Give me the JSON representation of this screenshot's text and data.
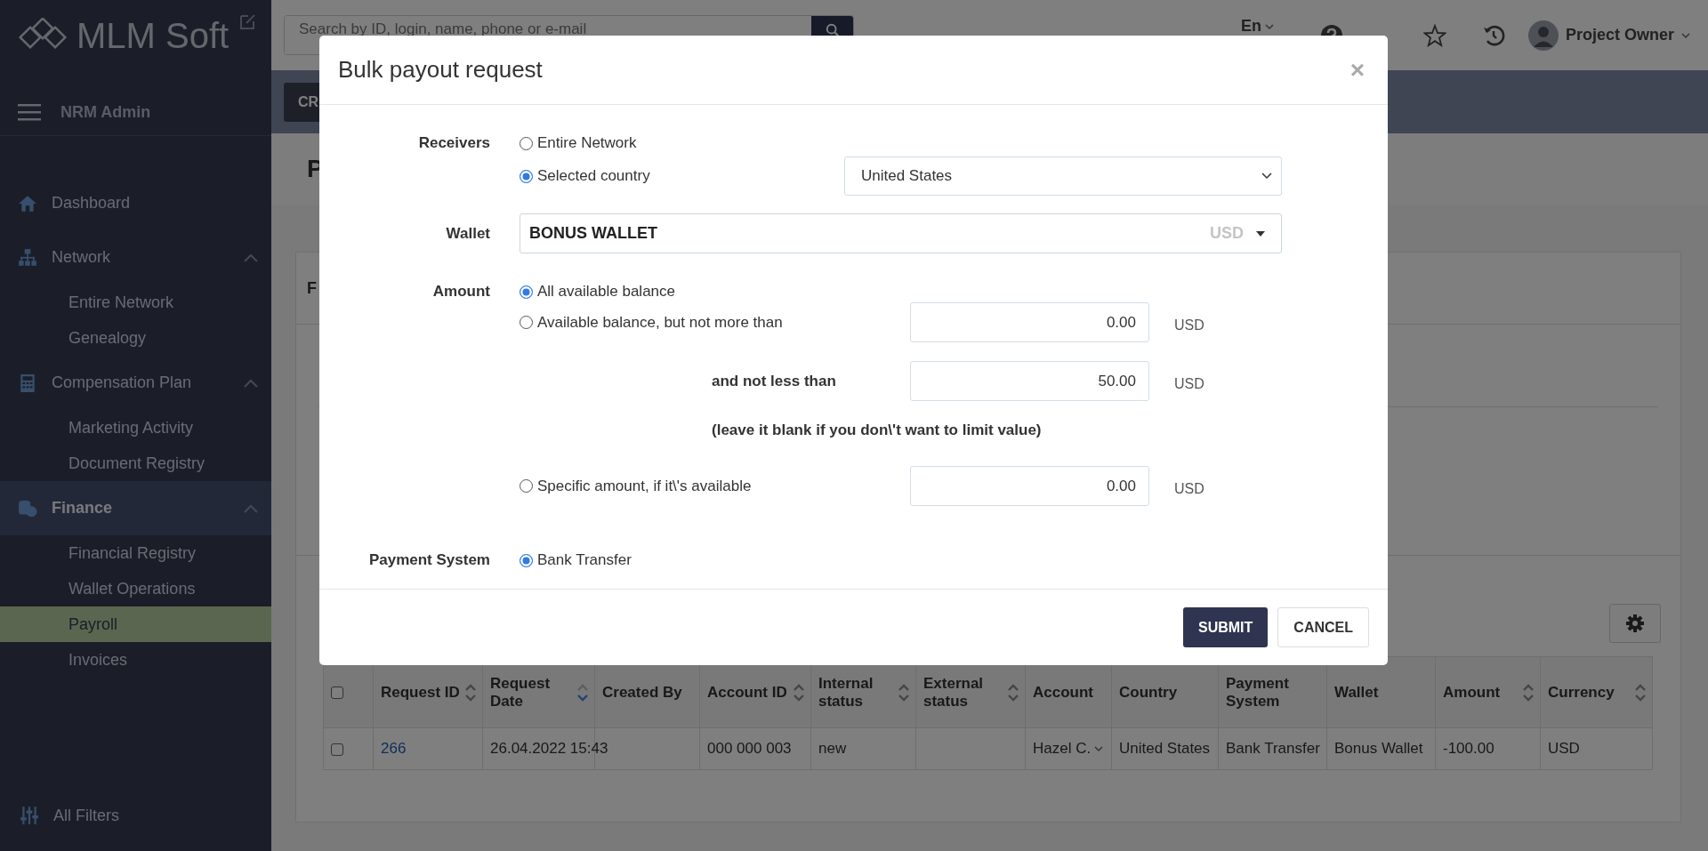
{
  "sidebar": {
    "logo": "MLM Soft",
    "title": "NRM Admin",
    "items": [
      {
        "label": "Dashboard",
        "selected": false
      },
      {
        "label": "Network",
        "selected": false,
        "expanded": true,
        "children": [
          {
            "label": "Entire Network",
            "selected": false
          },
          {
            "label": "Genealogy",
            "selected": false
          }
        ]
      },
      {
        "label": "Compensation Plan",
        "selected": false,
        "expanded": true,
        "children": [
          {
            "label": "Marketing Activity",
            "selected": false
          },
          {
            "label": "Document Registry",
            "selected": false
          }
        ]
      },
      {
        "label": "Finance",
        "selected": true,
        "expanded": true,
        "children": [
          {
            "label": "Financial Registry",
            "selected": false
          },
          {
            "label": "Wallet Operations",
            "selected": false
          },
          {
            "label": "Payroll",
            "selected": true
          },
          {
            "label": "Invoices",
            "selected": false
          }
        ]
      }
    ],
    "footer": "All Filters"
  },
  "topbar": {
    "search": {
      "placeholder": "Search by ID, login, name, phone or e-mail"
    },
    "language": "En",
    "user": "Project Owner"
  },
  "toolbar": {
    "button": "CR"
  },
  "page_title": "P",
  "card": {
    "heading": "F"
  },
  "table": {
    "header_checked": false,
    "columns": [
      {
        "label": "Request ID",
        "sorted": false
      },
      {
        "label": "Request Date",
        "sorted": true
      },
      {
        "label": "Created By"
      },
      {
        "label": "Account ID",
        "sorted": false
      },
      {
        "label": "Internal status",
        "sorted": false
      },
      {
        "label": "External status",
        "sorted": false
      },
      {
        "label": "Account"
      },
      {
        "label": "Country"
      },
      {
        "label": "Payment System"
      },
      {
        "label": "Wallet"
      },
      {
        "label": "Amount",
        "sorted": false
      },
      {
        "label": "Currency",
        "sorted": false
      }
    ],
    "rows": [
      {
        "checked": false,
        "cells": [
          {
            "text": "266",
            "kind": "link"
          },
          {
            "text": "26.04.2022 15:43",
            "kind": "text"
          },
          {
            "text": "",
            "kind": "text"
          },
          {
            "text": "000 000 003",
            "kind": "text"
          },
          {
            "text": "new",
            "kind": "text"
          },
          {
            "text": "",
            "kind": "text"
          },
          {
            "text": "Hazel C.",
            "kind": "dropdown"
          },
          {
            "text": "United States",
            "kind": "text"
          },
          {
            "text": "Bank Transfer",
            "kind": "text"
          },
          {
            "text": "Bonus Wallet",
            "kind": "text"
          },
          {
            "text": "-100.00",
            "kind": "text"
          },
          {
            "text": "USD",
            "kind": "text"
          }
        ]
      }
    ]
  },
  "modal": {
    "title": "Bulk payout request",
    "close": "×",
    "receivers": {
      "label": "Receivers",
      "options": [
        {
          "label": "Entire Network",
          "selected": false
        },
        {
          "label": "Selected country",
          "selected": true
        }
      ],
      "country": "United States"
    },
    "wallet": {
      "label": "Wallet",
      "value": "BONUS WALLET",
      "currency": "USD"
    },
    "amount": {
      "label": "Amount",
      "options": [
        {
          "label": "All available balance",
          "selected": true
        },
        {
          "label": "Available balance, but not more than",
          "selected": false,
          "value": "0.00",
          "currency": "USD"
        },
        {
          "label": "Specific amount, if it\\'s available",
          "selected": false,
          "value": "0.00",
          "currency": "USD"
        }
      ],
      "min_label": "and not less than",
      "min_value": "50.00",
      "min_currency": "USD",
      "hint": "(leave it blank if you don\\'t want to limit value)"
    },
    "payment_system": {
      "label": "Payment System",
      "options": [
        {
          "label": "Bank Transfer",
          "selected": true
        }
      ]
    },
    "buttons": [
      {
        "label": "SUBMIT",
        "kind": "primary"
      },
      {
        "label": "CANCEL",
        "kind": "secondary"
      }
    ]
  }
}
